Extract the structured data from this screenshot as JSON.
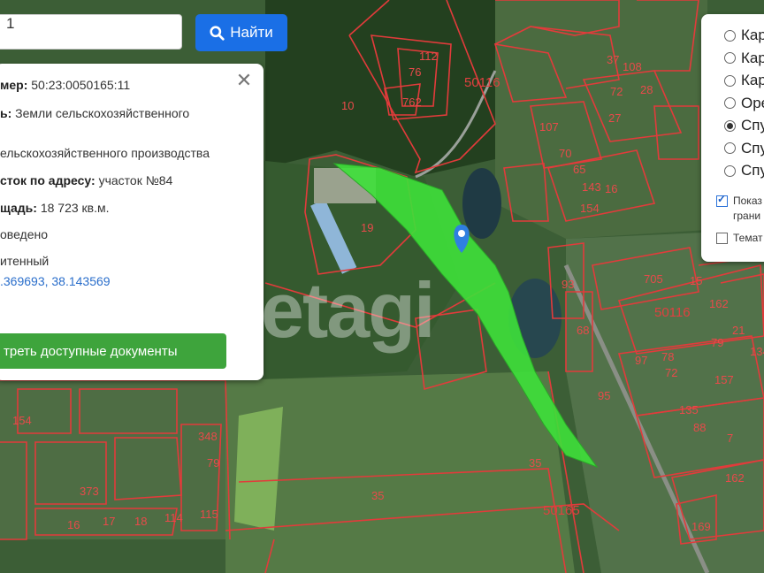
{
  "search": {
    "value": "1",
    "button_label": "Найти"
  },
  "info": {
    "rows": [
      {
        "key": "мер:",
        "value": "50:23:0050165:11"
      },
      {
        "key": "ь:",
        "value": "Земли сельскохозяйственного"
      },
      {
        "key": "",
        "value": "ельскохозяйственного производства"
      },
      {
        "key": "сток по адресу:",
        "value": "участок №84"
      },
      {
        "key": "щадь:",
        "value": "18 723 кв.м."
      },
      {
        "key": "",
        "value": "оведено"
      },
      {
        "key": "",
        "value": "итенный"
      },
      {
        "key": "",
        "value": ".369693, 38.143569"
      }
    ],
    "docs_button": "треть доступные документы",
    "close_icon": "close-icon"
  },
  "layers": {
    "radios": [
      {
        "label": "Кар",
        "checked": false
      },
      {
        "label": "Кар",
        "checked": false
      },
      {
        "label": "Кар",
        "checked": false
      },
      {
        "label": "Оре",
        "checked": false
      },
      {
        "label": "Спут",
        "checked": true
      },
      {
        "label": "Спут",
        "checked": false
      },
      {
        "label": "Спут",
        "checked": false
      }
    ],
    "checkboxes": [
      {
        "label_line1": "Показ",
        "label_line2": "грани",
        "checked": true
      },
      {
        "label_line1": "Темат",
        "label_line2": "",
        "checked": false
      }
    ]
  },
  "watermark": "etagi",
  "map_labels": [
    "50116",
    "10",
    "762",
    "112",
    "76",
    "19",
    "37",
    "108",
    "72",
    "28",
    "27",
    "107",
    "70",
    "65",
    "143",
    "16",
    "154",
    "93",
    "705",
    "15",
    "162",
    "50116",
    "79",
    "21",
    "68",
    "97",
    "78",
    "72",
    "134",
    "157",
    "95",
    "135",
    "88",
    "7",
    "162",
    "169",
    "35",
    "35",
    "50165",
    "348",
    "373",
    "115",
    "16",
    "114",
    "79",
    "154",
    "17",
    "18"
  ],
  "colors": {
    "accent_blue": "#1a6fe6",
    "docs_green": "#3ea43c",
    "parcel_line": "#e23b3b",
    "highlight": "#3ee03a"
  }
}
